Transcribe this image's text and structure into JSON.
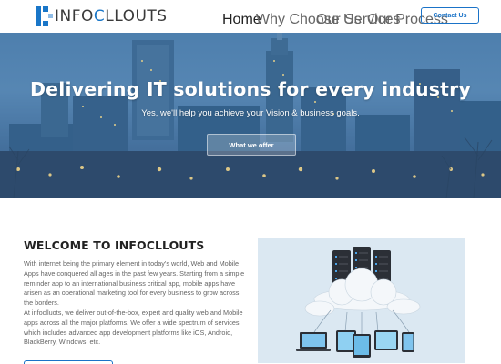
{
  "brand": {
    "logo_prefix": "INFO",
    "logo_highlight": "C",
    "logo_suffix": "LLOUTS"
  },
  "nav": {
    "links": [
      {
        "label": "Home",
        "active": true
      },
      {
        "label": "Why Choose Us",
        "active": false
      },
      {
        "label": "Our Services",
        "active": false
      },
      {
        "label": "Our Process",
        "active": false
      }
    ],
    "contact_label": "Contact Us"
  },
  "hero": {
    "title": "Delivering IT solutions for every industry",
    "subtitle": "Yes, we'll help you achieve your Vision & business goals.",
    "cta_label": "What we offer"
  },
  "welcome": {
    "title": "WELCOME TO INFOCLLOUTS",
    "paragraph1": "With internet being the primary element in today's world, Web and Mobile Apps have conquered all ages in the past few years. Starting from a simple reminder app to an international business critical app, mobile apps have arisen as an operational marketing tool for every business to grow across the borders.",
    "paragraph2": "At infoclluots, we deliver out-of-the-box, expert and quality web and Mobile apps across all the major platforms. We offer a wide spectrum of services which includes advanced app development platforms like iOS, Android, BlackBerry, Windows, etc."
  },
  "colors": {
    "brand_blue": "#1976c8",
    "hero_overlay": "#4d7fad",
    "illus_bg": "#dbe8f2"
  },
  "icons": [
    "logo-mark-icon",
    "server-icon",
    "cloud-icon",
    "laptop-icon"
  ]
}
